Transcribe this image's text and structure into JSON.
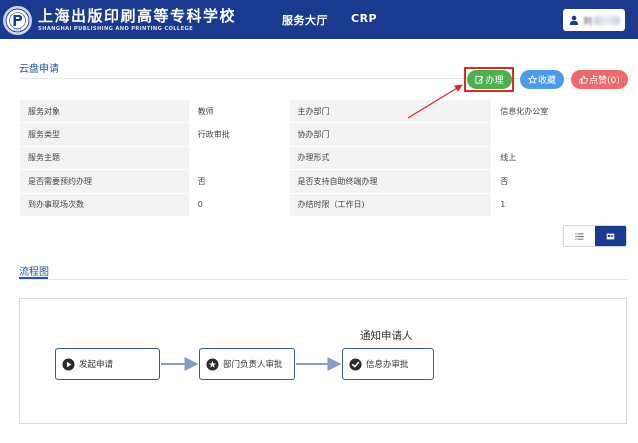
{
  "header": {
    "school_name_cn": "上海出版印刷高等专科学校",
    "school_name_en": "SHANGHAI PUBLISHING AND PRINTING COLLEGE",
    "nav": [
      {
        "label": "服务大厅"
      },
      {
        "label": "CRP"
      }
    ],
    "user_name": "刘"
  },
  "page": {
    "title": "云盘申请"
  },
  "actions": {
    "handle_label": "办理",
    "favorite_label": "收藏",
    "like_label": "点赞(0)"
  },
  "info": {
    "rows": [
      {
        "l1": "服务对象",
        "v1": "教师",
        "l2": "主办部门",
        "v2": "信息化办公室"
      },
      {
        "l1": "服务类型",
        "v1": "行政审批",
        "l2": "协办部门",
        "v2": ""
      },
      {
        "l1": "服务主题",
        "v1": "",
        "l2": "办理形式",
        "v2": "线上"
      },
      {
        "l1": "是否需要预约办理",
        "v1": "否",
        "l2": "是否支持自助终端办理",
        "v2": "否"
      },
      {
        "l1": "到办事现场次数",
        "v1": "0",
        "l2": "办结时限（工作日)",
        "v2": "1"
      }
    ]
  },
  "flow": {
    "tab_label": "流程图",
    "nodes": [
      {
        "label": "发起申请",
        "icon": "play-icon"
      },
      {
        "label": "部门负责人审批",
        "icon": "star-icon"
      },
      {
        "label": "信息办审批",
        "icon": "check-icon"
      }
    ],
    "notify_label": "通知申请人"
  },
  "colors": {
    "header_bg": "#1a3a8f",
    "accent": "#2456a6",
    "handle": "#4caf50",
    "favorite": "#4d9be8",
    "like": "#e96b6b",
    "annotation": "#e02828"
  }
}
